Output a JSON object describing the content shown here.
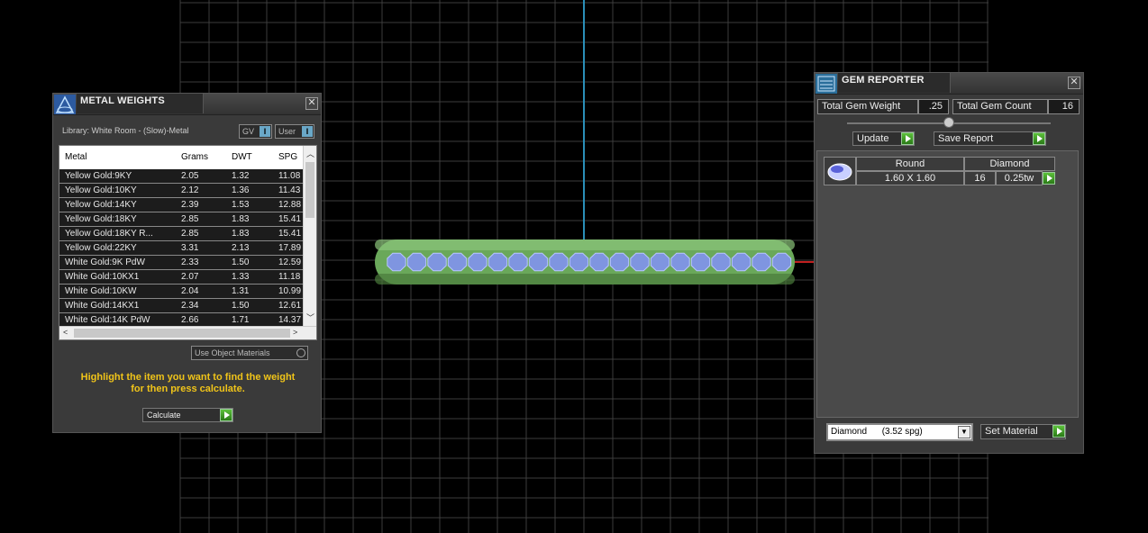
{
  "metal_weights": {
    "title": "METAL WEIGHTS",
    "library_label": "Library: White Room - (Slow)-Metal",
    "gv_label": "GV",
    "user_label": "User",
    "info_badge": "I",
    "columns": [
      "Metal",
      "Grams",
      "DWT",
      "SPG"
    ],
    "rows": [
      {
        "metal": "Yellow Gold:9KY",
        "grams": "2.05",
        "dwt": "1.32",
        "spg": "11.08"
      },
      {
        "metal": "Yellow Gold:10KY",
        "grams": "2.12",
        "dwt": "1.36",
        "spg": "11.43"
      },
      {
        "metal": "Yellow Gold:14KY",
        "grams": "2.39",
        "dwt": "1.53",
        "spg": "12.88"
      },
      {
        "metal": "Yellow Gold:18KY",
        "grams": "2.85",
        "dwt": "1.83",
        "spg": "15.41"
      },
      {
        "metal": "Yellow Gold:18KY R...",
        "grams": "2.85",
        "dwt": "1.83",
        "spg": "15.41"
      },
      {
        "metal": "Yellow Gold:22KY",
        "grams": "3.31",
        "dwt": "2.13",
        "spg": "17.89"
      },
      {
        "metal": "White Gold:9K PdW",
        "grams": "2.33",
        "dwt": "1.50",
        "spg": "12.59"
      },
      {
        "metal": "White Gold:10KX1",
        "grams": "2.07",
        "dwt": "1.33",
        "spg": "11.18"
      },
      {
        "metal": "White Gold:10KW",
        "grams": "2.04",
        "dwt": "1.31",
        "spg": "10.99"
      },
      {
        "metal": "White Gold:14KX1",
        "grams": "2.34",
        "dwt": "1.50",
        "spg": "12.61"
      },
      {
        "metal": "White Gold:14K PdW",
        "grams": "2.66",
        "dwt": "1.71",
        "spg": "14.37"
      }
    ],
    "use_object_materials_label": "Use Object Materials",
    "message_line1": "Highlight the item you want to find the weight",
    "message_line2": "for then press calculate.",
    "calculate_label": "Calculate"
  },
  "gem_reporter": {
    "title": "GEM REPORTER",
    "total_weight_label": "Total Gem Weight",
    "total_weight_value": ".25",
    "total_count_label": "Total Gem Count",
    "total_count_value": "16",
    "update_label": "Update",
    "save_report_label": "Save Report",
    "gem": {
      "shape": "Round",
      "size": "1.60 X 1.60",
      "material": "Diamond",
      "count": "16",
      "weight": "0.25tw"
    },
    "material_select": "Diamond      (3.52 spg)",
    "set_material_label": "Set Material"
  },
  "colors": {
    "accent_yellow": "#f0c419",
    "button_green": "#3a9a22",
    "axis_blue": "#2a8fb8",
    "axis_red": "#c02020"
  }
}
